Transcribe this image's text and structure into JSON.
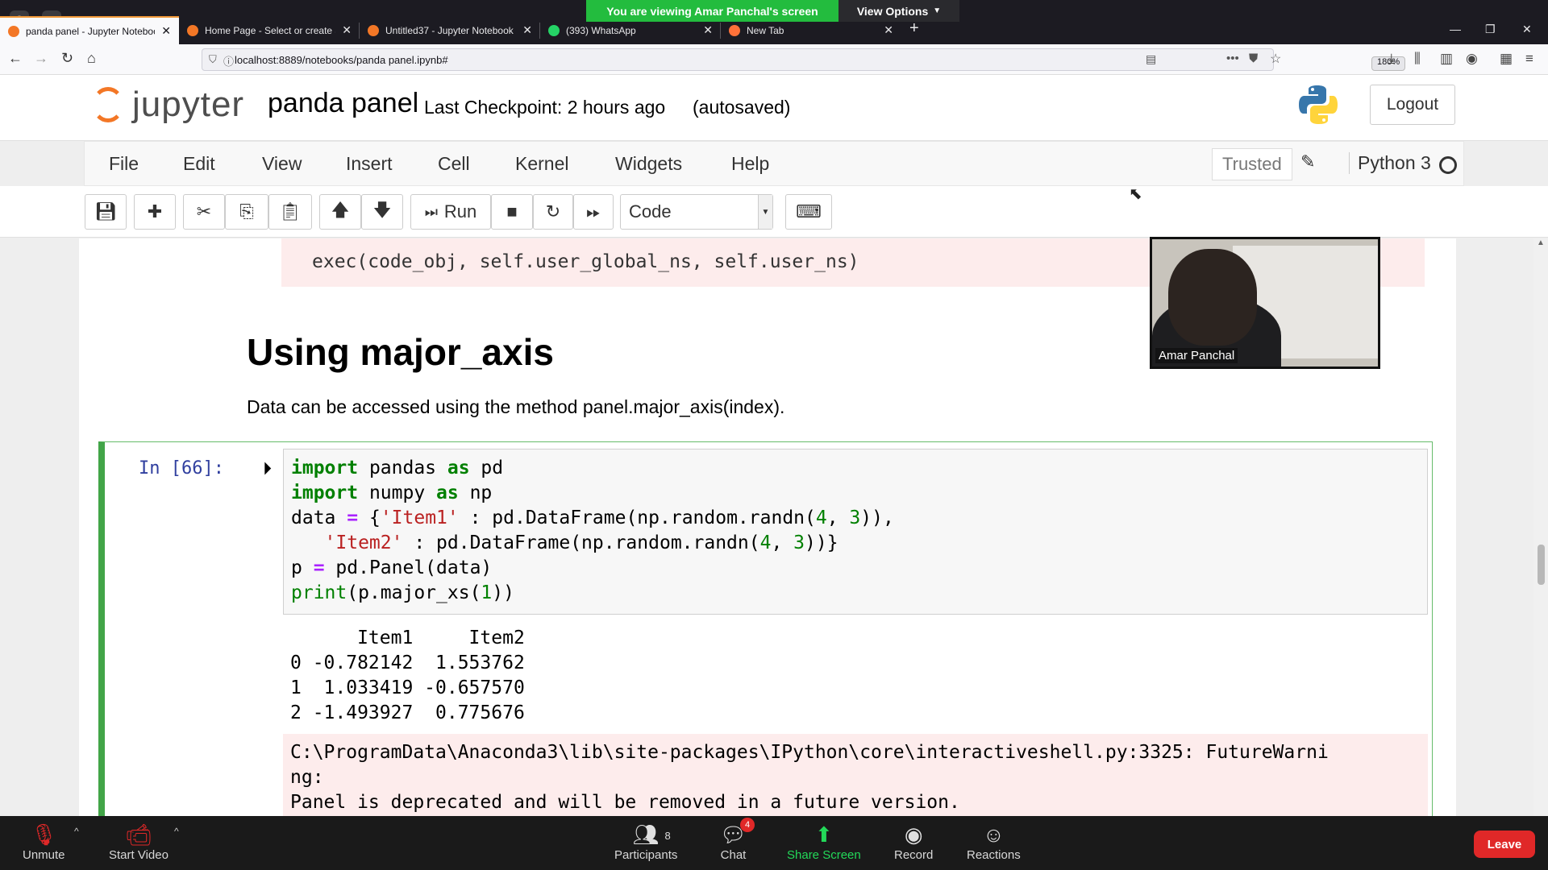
{
  "browser": {
    "tabs": [
      {
        "title": "panda panel - Jupyter Noteboo",
        "active": true,
        "color": "#f37726"
      },
      {
        "title": "Home Page - Select or create a",
        "active": false,
        "color": "#f37726"
      },
      {
        "title": "Untitled37 - Jupyter Notebook",
        "active": false,
        "color": "#f37726"
      },
      {
        "title": "(393) WhatsApp",
        "active": false,
        "color": "#25d366"
      },
      {
        "title": "New Tab",
        "active": false,
        "color": "#ff7139"
      }
    ],
    "url": "localhost:8889/notebooks/panda panel.ipynb#",
    "zoom": "180%"
  },
  "share": {
    "banner": "You are viewing Amar Panchal's screen",
    "view_options": "View Options"
  },
  "jupyter": {
    "logo_text": "jupyter",
    "notebook_title": "panda panel",
    "checkpoint": "Last Checkpoint: 2 hours ago",
    "autosave": "(autosaved)",
    "logout": "Logout",
    "menu": [
      "File",
      "Edit",
      "View",
      "Insert",
      "Cell",
      "Kernel",
      "Widgets",
      "Help"
    ],
    "trusted": "Trusted",
    "kernel": "Python 3",
    "run_label": "Run",
    "cell_type": "Code"
  },
  "notebook": {
    "prev_error_line": "exec(code_obj, self.user_global_ns, self.user_ns)",
    "heading": "Using major_axis",
    "paragraph": "Data can be accessed using the method panel.major_axis(index).",
    "cell_prompt": "In [66]:",
    "code": [
      "import pandas as pd",
      "import numpy as np",
      "data = {'Item1' : pd.DataFrame(np.random.randn(4, 3)),",
      "   'Item2' : pd.DataFrame(np.random.randn(4, 3))}",
      "p = pd.Panel(data)",
      "print(p.major_xs(1))"
    ],
    "output": [
      "      Item1     Item2",
      "0 -0.782142  1.553762",
      "1  1.033419 -0.657570",
      "2 -1.493927  0.775676"
    ],
    "stderr": [
      "C:\\ProgramData\\Anaconda3\\lib\\site-packages\\IPython\\core\\interactiveshell.py:3325: FutureWarni",
      "ng:",
      "Panel is deprecated and will be removed in a future version."
    ]
  },
  "video": {
    "participant_name": "Amar Panchal"
  },
  "zoom_controls": {
    "unmute": "Unmute",
    "start_video": "Start Video",
    "participants": "Participants",
    "participants_count": "8",
    "chat": "Chat",
    "chat_badge": "4",
    "share_screen": "Share Screen",
    "record": "Record",
    "reactions": "Reactions",
    "leave": "Leave"
  }
}
